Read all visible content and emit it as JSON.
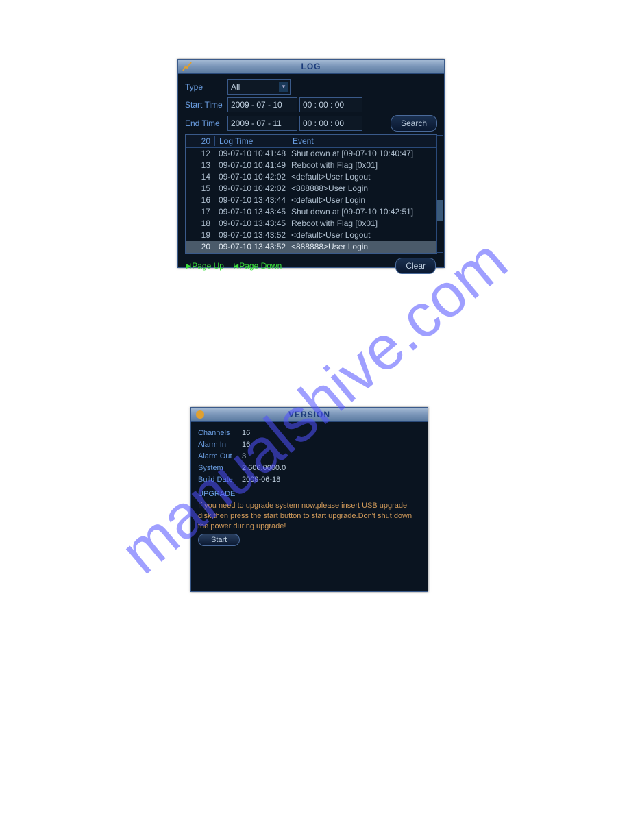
{
  "watermark": "manualshive.com",
  "log": {
    "title": "LOG",
    "type_label": "Type",
    "type_value": "All",
    "start_label": "Start Time",
    "start_date": "2009 - 07 - 10",
    "start_time": "00 : 00 : 00",
    "end_label": "End Time",
    "end_date": "2009 - 07 - 11",
    "end_time": "00 : 00 : 00",
    "search_btn": "Search",
    "count": "20",
    "col_time": "Log Time",
    "col_event": "Event",
    "rows": [
      {
        "idx": "12",
        "time": "09-07-10 10:41:48",
        "event": "Shut down at [09-07-10 10:40:47]"
      },
      {
        "idx": "13",
        "time": "09-07-10 10:41:49",
        "event": "Reboot with Flag [0x01]"
      },
      {
        "idx": "14",
        "time": "09-07-10 10:42:02",
        "event": "<default>User Logout"
      },
      {
        "idx": "15",
        "time": "09-07-10 10:42:02",
        "event": "<888888>User Login"
      },
      {
        "idx": "16",
        "time": "09-07-10 13:43:44",
        "event": "<default>User Login"
      },
      {
        "idx": "17",
        "time": "09-07-10 13:43:45",
        "event": "Shut down at [09-07-10 10:42:51]"
      },
      {
        "idx": "18",
        "time": "09-07-10 13:43:45",
        "event": "Reboot with Flag [0x01]"
      },
      {
        "idx": "19",
        "time": "09-07-10 13:43:52",
        "event": "<default>User Logout"
      },
      {
        "idx": "20",
        "time": "09-07-10 13:43:52",
        "event": "<888888>User Login"
      }
    ],
    "selected_index": 8,
    "page_up": "Page Up",
    "page_down": "Page Down",
    "clear_btn": "Clear"
  },
  "version": {
    "title": "VERSION",
    "fields": [
      {
        "label": "Channels",
        "value": "16"
      },
      {
        "label": "Alarm In",
        "value": "16"
      },
      {
        "label": "Alarm Out",
        "value": "3"
      },
      {
        "label": "System",
        "value": "2.606.0000.0"
      },
      {
        "label": "Build Date",
        "value": "2009-06-18"
      }
    ],
    "upgrade_title": "UPGRADE",
    "upgrade_text": "If you need to upgrade system now,please insert USB upgrade disk,then press the start button to start upgrade.Don't shut down the power during upgrade!",
    "start_btn": "Start"
  }
}
